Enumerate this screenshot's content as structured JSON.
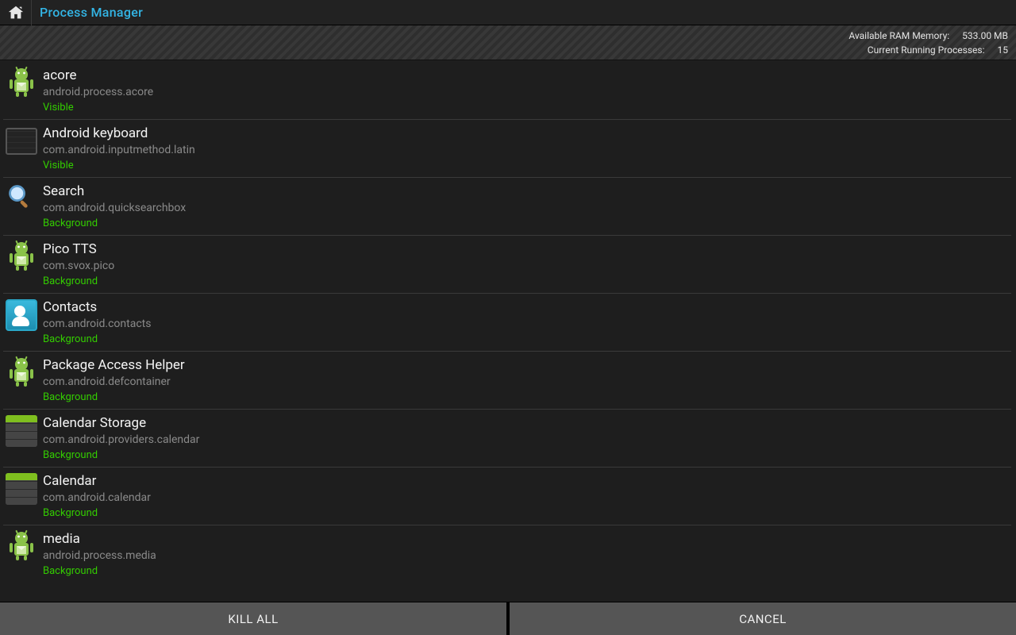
{
  "header": {
    "title": "Process Manager"
  },
  "status": {
    "ram_label": "Available RAM Memory:",
    "ram_value": "533.00 MB",
    "proc_label": "Current Running Processes:",
    "proc_value": "15"
  },
  "processes": [
    {
      "name": "acore",
      "package": "android.process.acore",
      "state": "Visible",
      "icon": "android"
    },
    {
      "name": "Android keyboard",
      "package": "com.android.inputmethod.latin",
      "state": "Visible",
      "icon": "keyboard"
    },
    {
      "name": "Search",
      "package": "com.android.quicksearchbox",
      "state": "Background",
      "icon": "search"
    },
    {
      "name": "Pico TTS",
      "package": "com.svox.pico",
      "state": "Background",
      "icon": "android"
    },
    {
      "name": "Contacts",
      "package": "com.android.contacts",
      "state": "Background",
      "icon": "contacts"
    },
    {
      "name": "Package Access Helper",
      "package": "com.android.defcontainer",
      "state": "Background",
      "icon": "android"
    },
    {
      "name": "Calendar Storage",
      "package": "com.android.providers.calendar",
      "state": "Background",
      "icon": "calendar"
    },
    {
      "name": "Calendar",
      "package": "com.android.calendar",
      "state": "Background",
      "icon": "calendar"
    },
    {
      "name": "media",
      "package": "android.process.media",
      "state": "Background",
      "icon": "android"
    }
  ],
  "buttons": {
    "kill_all": "KILL ALL",
    "cancel": "CANCEL"
  }
}
